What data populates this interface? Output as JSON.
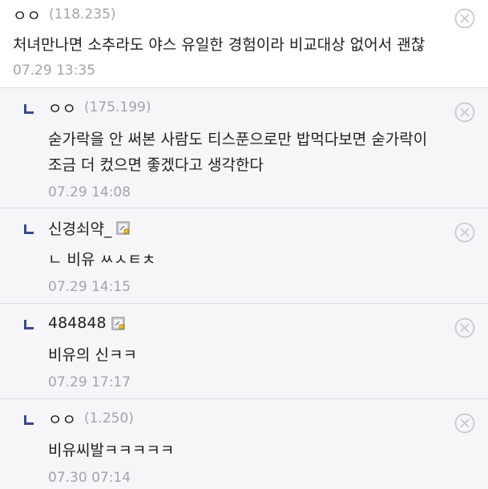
{
  "comments": [
    {
      "author": "ㅇㅇ",
      "ip": "(118.235)",
      "body": "처녀만나면 소추라도 야스 유일한 경험이라 비교대상 없어서 괜찮",
      "time": "07.29 13:35"
    },
    {
      "author": "ㅇㅇ",
      "ip": "(175.199)",
      "body": "숟가락을 안 써본 사람도 티스푼으로만 밥먹다보면 숟가락이 조금 더 컸으면 좋겠다고 생각한다",
      "time": "07.29 14:08"
    },
    {
      "author": "신경쇠약_",
      "body": "ㄴ 비유 ㅆㅅㅌㅊ",
      "time": "07.29 14:15"
    },
    {
      "author": "484848",
      "body": "비유의 신ㅋㅋ",
      "time": "07.29 17:17"
    },
    {
      "author": "ㅇㅇ",
      "ip": "(1.250)",
      "body": "비유씨발ㅋㅋㅋㅋㅋ",
      "time": "07.30 07:14"
    }
  ],
  "icons": {
    "delete": "close-circle-icon",
    "reply": "reply-arrow-icon",
    "member": "gallery-member-badge-icon"
  },
  "colors": {
    "reply_arrow": "#3b4890",
    "meta_gray": "#a3a3aa",
    "reply_background": "#f6f6f8",
    "divider": "#dcdde3"
  }
}
